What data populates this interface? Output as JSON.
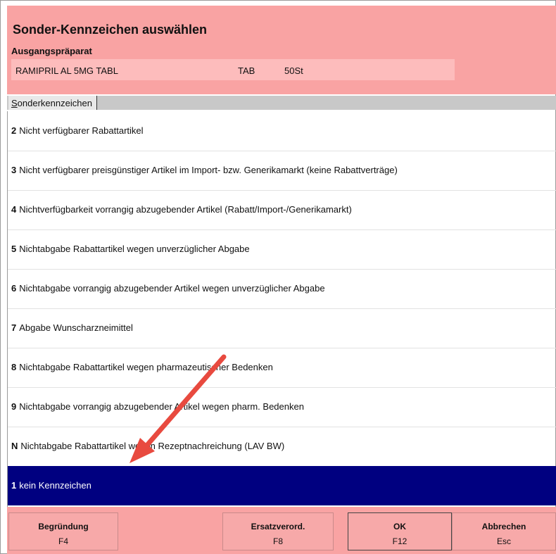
{
  "dialog": {
    "title": "Sonder-Kennzeichen auswählen",
    "subtitle": "Ausgangspräparat",
    "product": {
      "name": "RAMIPRIL AL 5MG TABL",
      "form": "TAB",
      "pack": "50St"
    }
  },
  "tab": {
    "first_letter": "S",
    "rest": "onderkennzeichen"
  },
  "options": [
    {
      "key": "2",
      "text": "Nicht verfügbarer Rabattartikel"
    },
    {
      "key": "3",
      "text": "Nicht verfügbarer preisgünstiger Artikel im Import- bzw. Generikamarkt (keine Rabattverträge)"
    },
    {
      "key": "4",
      "text": "Nichtverfügbarkeit vorrangig abzugebender Artikel (Rabatt/Import-/Generikamarkt)"
    },
    {
      "key": "5",
      "text": "Nichtabgabe Rabattartikel wegen unverzüglicher Abgabe"
    },
    {
      "key": "6",
      "text": "Nichtabgabe vorrangig abzugebender Artikel wegen unverzüglicher Abgabe"
    },
    {
      "key": "7",
      "text": "Abgabe Wunscharzneimittel"
    },
    {
      "key": "8",
      "text": "Nichtabgabe Rabattartikel wegen pharmazeutischer Bedenken"
    },
    {
      "key": "9",
      "text": "Nichtabgabe vorrangig abzugebender Artikel wegen pharm. Bedenken"
    },
    {
      "key": "N",
      "text": "Nichtabgabe Rabattartikel wegen Rezeptnachreichung (LAV BW)"
    },
    {
      "key": "1",
      "text": "kein Kennzeichen",
      "selected": true
    }
  ],
  "buttons": {
    "begruendung": {
      "label": "Begründung",
      "key": "F4"
    },
    "ersatz": {
      "label": "Ersatzverord.",
      "key": "F8"
    },
    "ok": {
      "label": "OK",
      "key": "F12"
    },
    "abbrechen": {
      "label": "Abbrechen",
      "key": "Esc"
    }
  },
  "colors": {
    "header_bg": "#f9a3a3",
    "selected_bg": "#000080",
    "annotation_arrow": "#e84a3f"
  }
}
